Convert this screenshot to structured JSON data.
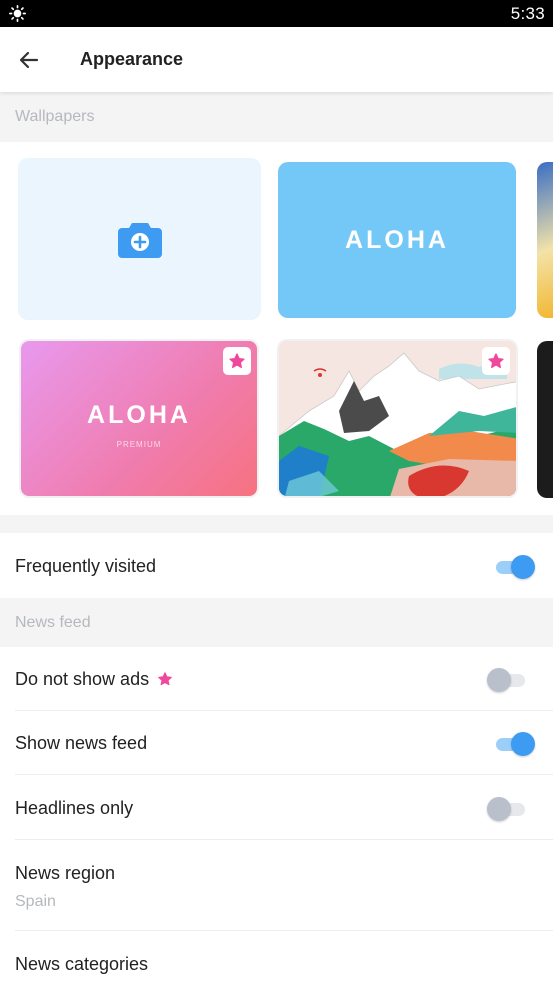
{
  "status_bar": {
    "time": "5:33",
    "icon": "brightness-icon"
  },
  "app_bar": {
    "title": "Appearance",
    "back_icon": "arrow-left-icon"
  },
  "wallpapers": {
    "header": "Wallpapers",
    "tiles": [
      {
        "kind": "add-photo",
        "icon": "camera-plus-icon"
      },
      {
        "kind": "aloha-blue",
        "label": "ALOHA",
        "color": "#74c8f8"
      },
      {
        "kind": "aloha-premium",
        "label": "ALOHA",
        "sublabel": "PREMIUM",
        "premium": true
      },
      {
        "kind": "landscape-art",
        "premium": true
      }
    ]
  },
  "settings": {
    "frequently_visited": {
      "label": "Frequently visited",
      "enabled": true
    },
    "news_feed_header": "News feed",
    "do_not_show_ads": {
      "label": "Do not show ads",
      "enabled": false,
      "premium": true
    },
    "show_news_feed": {
      "label": "Show news feed",
      "enabled": true
    },
    "headlines_only": {
      "label": "Headlines only",
      "enabled": false
    },
    "news_region": {
      "label": "News region",
      "value": "Spain"
    },
    "news_categories": {
      "label": "News categories"
    }
  },
  "colors": {
    "accent": "#3d9bf1",
    "premium_pink": "#f0489c",
    "section_bg": "#f4f4f5",
    "muted_text": "#b5b8bd"
  }
}
